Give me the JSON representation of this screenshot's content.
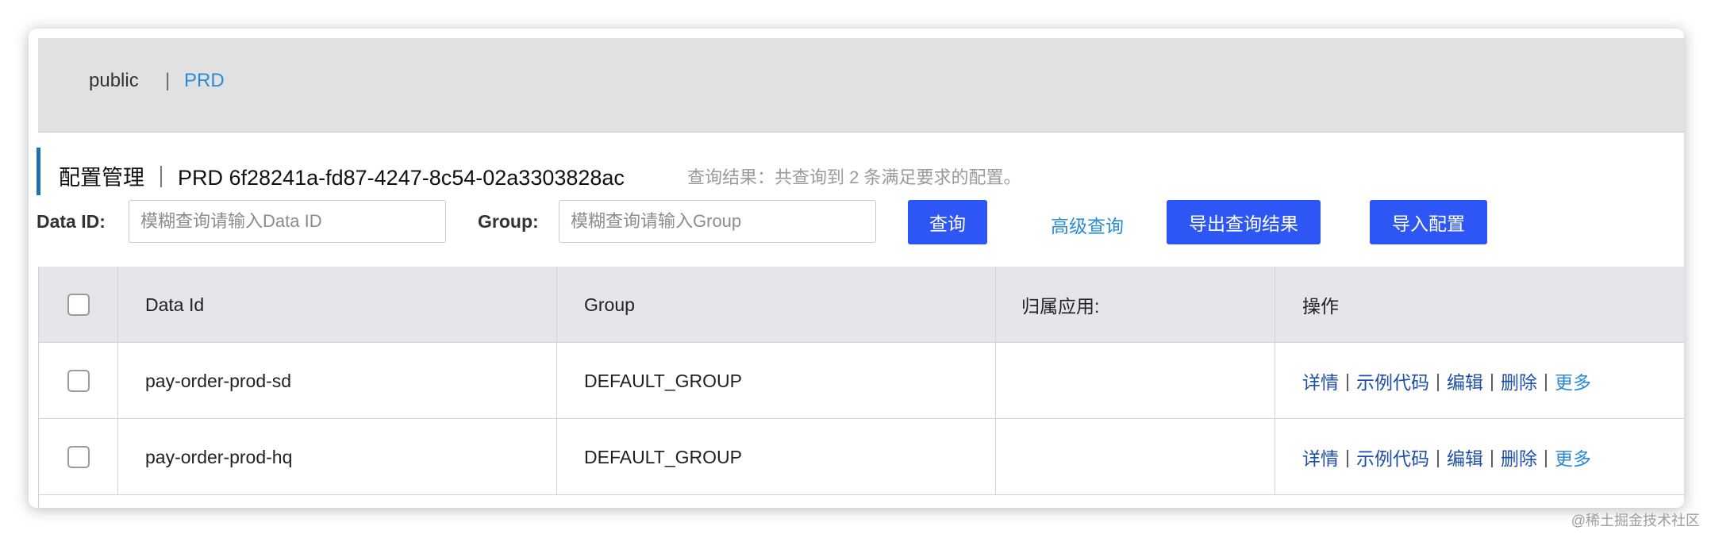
{
  "namespace": {
    "public": "public",
    "separator": "|",
    "current": "PRD"
  },
  "header": {
    "title": "配置管理 ｜ PRD  6f28241a-fd87-4247-8c54-02a3303828ac",
    "result": "查询结果：共查询到 2 条满足要求的配置。"
  },
  "search": {
    "data_id_label": "Data ID:",
    "data_id_placeholder": "模糊查询请输入Data ID",
    "group_label": "Group:",
    "group_placeholder": "模糊查询请输入Group",
    "query_button": "查询",
    "advanced_link": "高级查询",
    "export_button": "导出查询结果",
    "import_button": "导入配置"
  },
  "table": {
    "columns": [
      "Data Id",
      "Group",
      "归属应用:",
      "操作"
    ],
    "rows": [
      {
        "data_id": "pay-order-prod-sd",
        "group": "DEFAULT_GROUP",
        "app": ""
      },
      {
        "data_id": "pay-order-prod-hq",
        "group": "DEFAULT_GROUP",
        "app": ""
      }
    ],
    "actions": {
      "detail": "详情",
      "sample": "示例代码",
      "edit": "编辑",
      "delete": "删除",
      "more": "更多",
      "sep": "|"
    }
  },
  "watermark": "@稀土掘金技术社区",
  "colors": {
    "primary_button": "#2d56f5",
    "link": "#2a8bd8",
    "action_link": "#1f4ea8",
    "title_accent": "#1f6fb5"
  }
}
